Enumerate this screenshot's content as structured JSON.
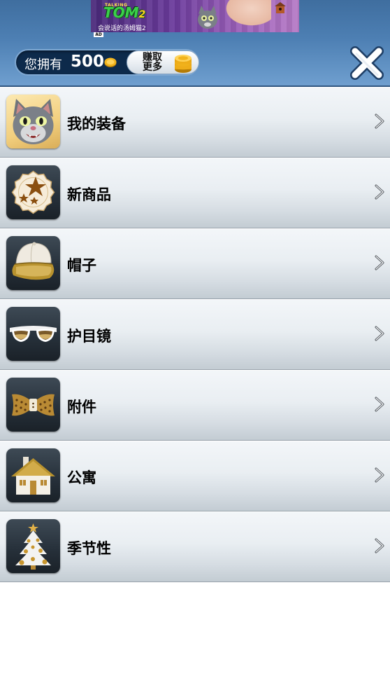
{
  "ad": {
    "tagline_top": "TALKING",
    "title": "TOM",
    "title_suffix": "2",
    "subtitle": "会说话的汤姆猫2",
    "badge": "AD"
  },
  "header": {
    "coins_label": "您拥有",
    "coins_count": "500",
    "earn_label": "赚取更多",
    "earn_line1": "赚取",
    "earn_line2": "更多"
  },
  "colors": {
    "header_blue": "#4d7fb3",
    "pill_navy": "#0d2a4b",
    "coin_gold": "#f2b41d"
  },
  "menu": {
    "items": [
      {
        "label": "我的装备",
        "icon": "talking-tom-avatar-icon"
      },
      {
        "label": "新商品",
        "icon": "stars-badge-icon"
      },
      {
        "label": "帽子",
        "icon": "baseball-cap-icon"
      },
      {
        "label": "护目镜",
        "icon": "sunglasses-icon"
      },
      {
        "label": "附件",
        "icon": "bow-tie-icon"
      },
      {
        "label": "公寓",
        "icon": "house-icon"
      },
      {
        "label": "季节性",
        "icon": "christmas-tree-icon"
      }
    ]
  }
}
